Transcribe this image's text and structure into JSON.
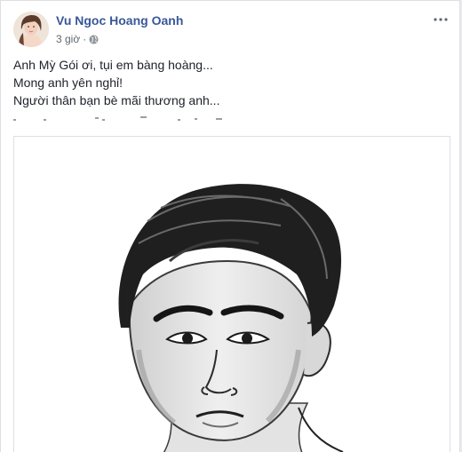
{
  "post": {
    "author": "Vu Ngoc Hoang Oanh",
    "time": "3 giờ",
    "separator": "·",
    "privacy_icon": "globe-icon",
    "more_icon": "more-horizontal-icon",
    "lines": [
      "Anh Mỳ Gói ơi, tụi em bàng hoàng...",
      "Mong anh yên nghỉ!",
      "Người thân bạn bè mãi thương anh..."
    ],
    "image_icon": "portrait-sketch-image"
  },
  "colors": {
    "name_blue": "#385898",
    "meta_gray": "#616770",
    "text": "#1d2129",
    "border": "#dddfe2"
  }
}
